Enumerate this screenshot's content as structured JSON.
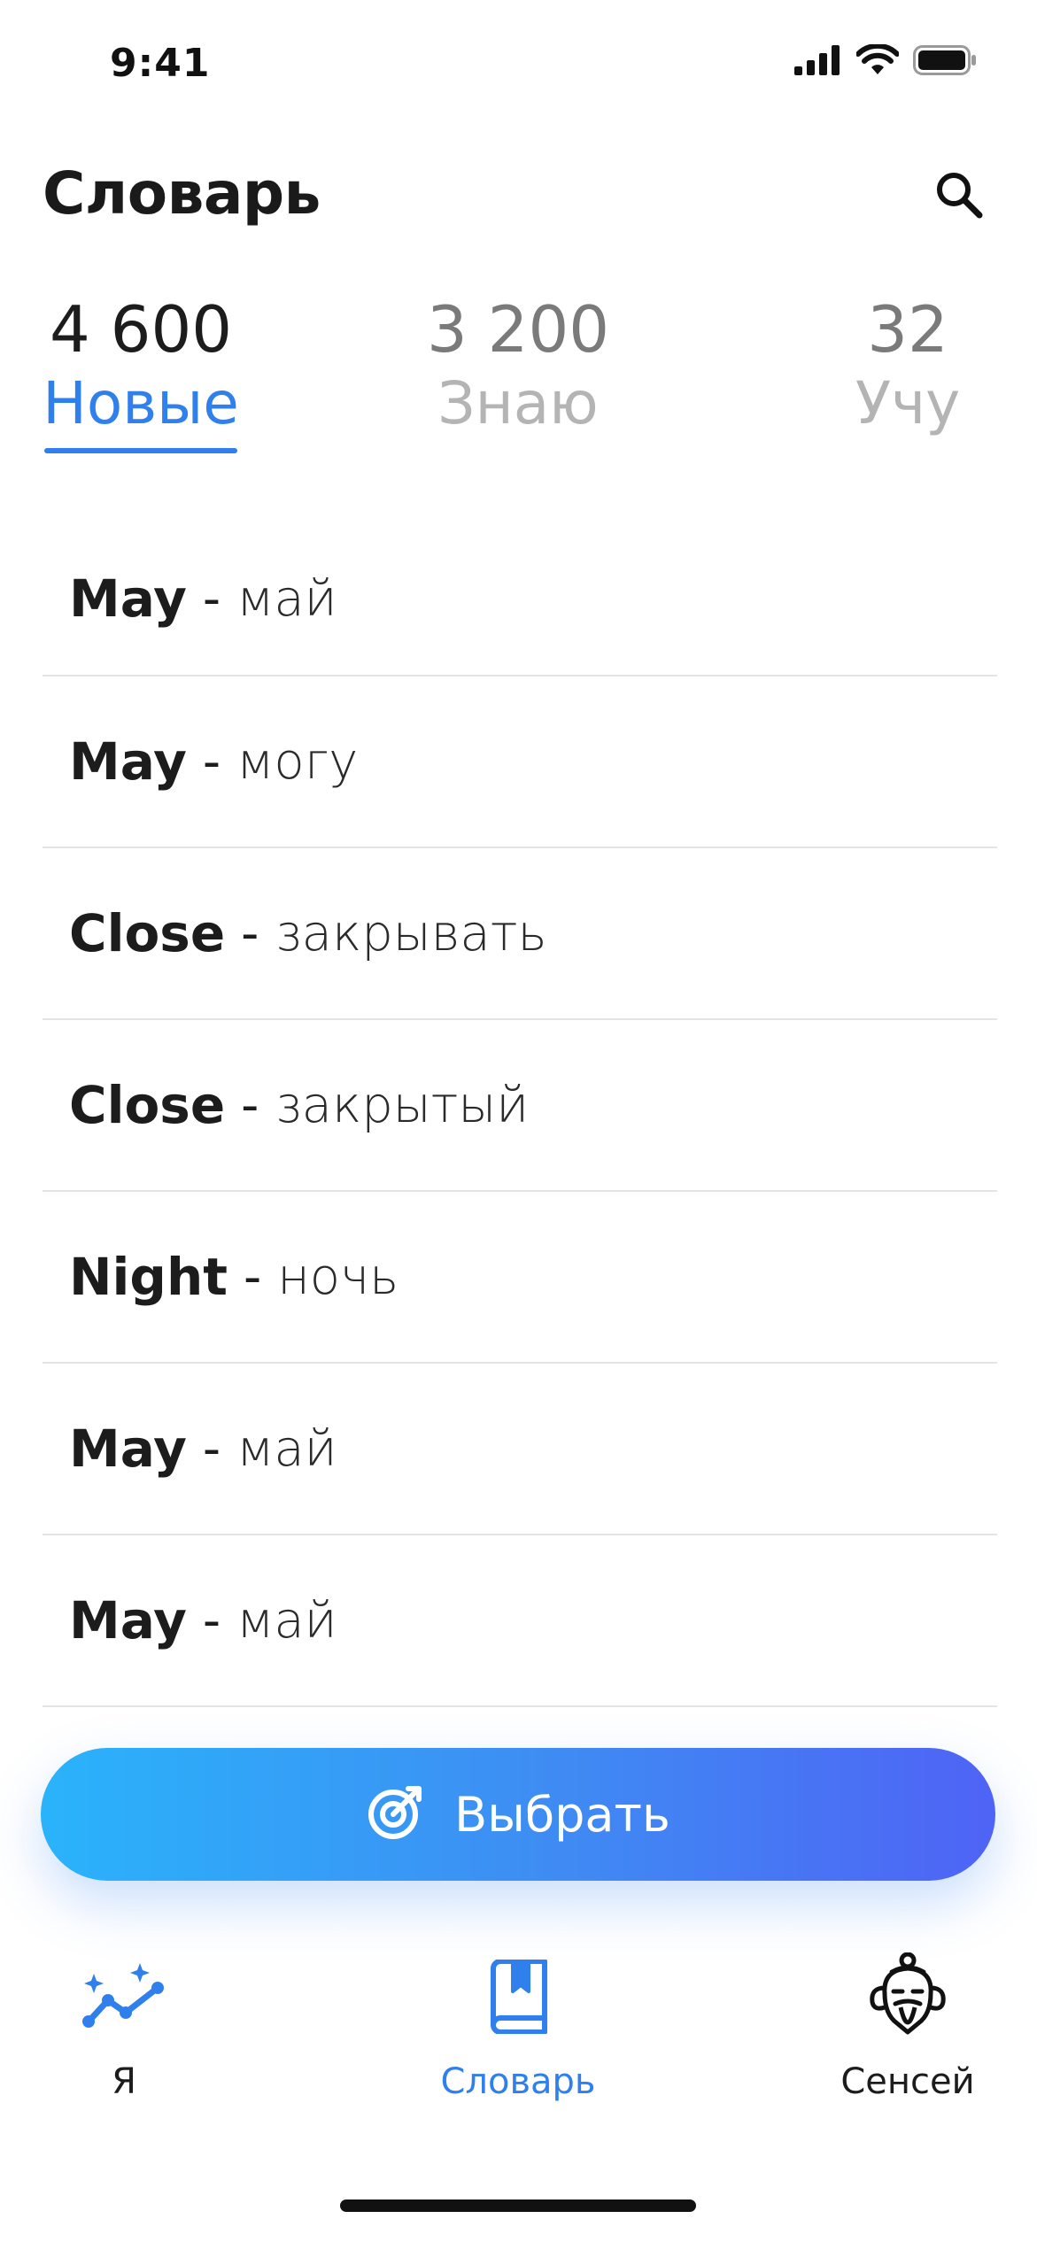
{
  "status_bar": {
    "time": "9:41"
  },
  "header": {
    "title": "Словарь"
  },
  "stats_tabs": [
    {
      "count": "4 600",
      "label": "Новые",
      "active": true
    },
    {
      "count": "3 200",
      "label": "Знаю",
      "active": false
    },
    {
      "count": "32",
      "label": "Учу",
      "active": false
    }
  ],
  "words": [
    {
      "en": "May",
      "sep": "-",
      "ru": "май"
    },
    {
      "en": "May",
      "sep": "-",
      "ru": "могу"
    },
    {
      "en": "Close",
      "sep": "-",
      "ru": "закрывать"
    },
    {
      "en": "Close",
      "sep": "-",
      "ru": "закрытый"
    },
    {
      "en": "Night",
      "sep": "-",
      "ru": "ночь"
    },
    {
      "en": "May",
      "sep": "-",
      "ru": "май"
    },
    {
      "en": "May",
      "sep": "-",
      "ru": "май"
    }
  ],
  "action": {
    "label": "Выбрать",
    "icon": "target-icon"
  },
  "tab_bar": [
    {
      "label": "Я",
      "icon": "progress-sparkle-icon",
      "active": false
    },
    {
      "label": "Словарь",
      "icon": "bookmark-book-icon",
      "active": true
    },
    {
      "label": "Сенсей",
      "icon": "sensei-face-icon",
      "active": false
    }
  ],
  "colors": {
    "accent": "#2f80ed",
    "gradient_start": "#2ab3fb",
    "gradient_end": "#4f63f5",
    "muted_text": "#b4b4b4",
    "divider": "#e4e4e4"
  }
}
